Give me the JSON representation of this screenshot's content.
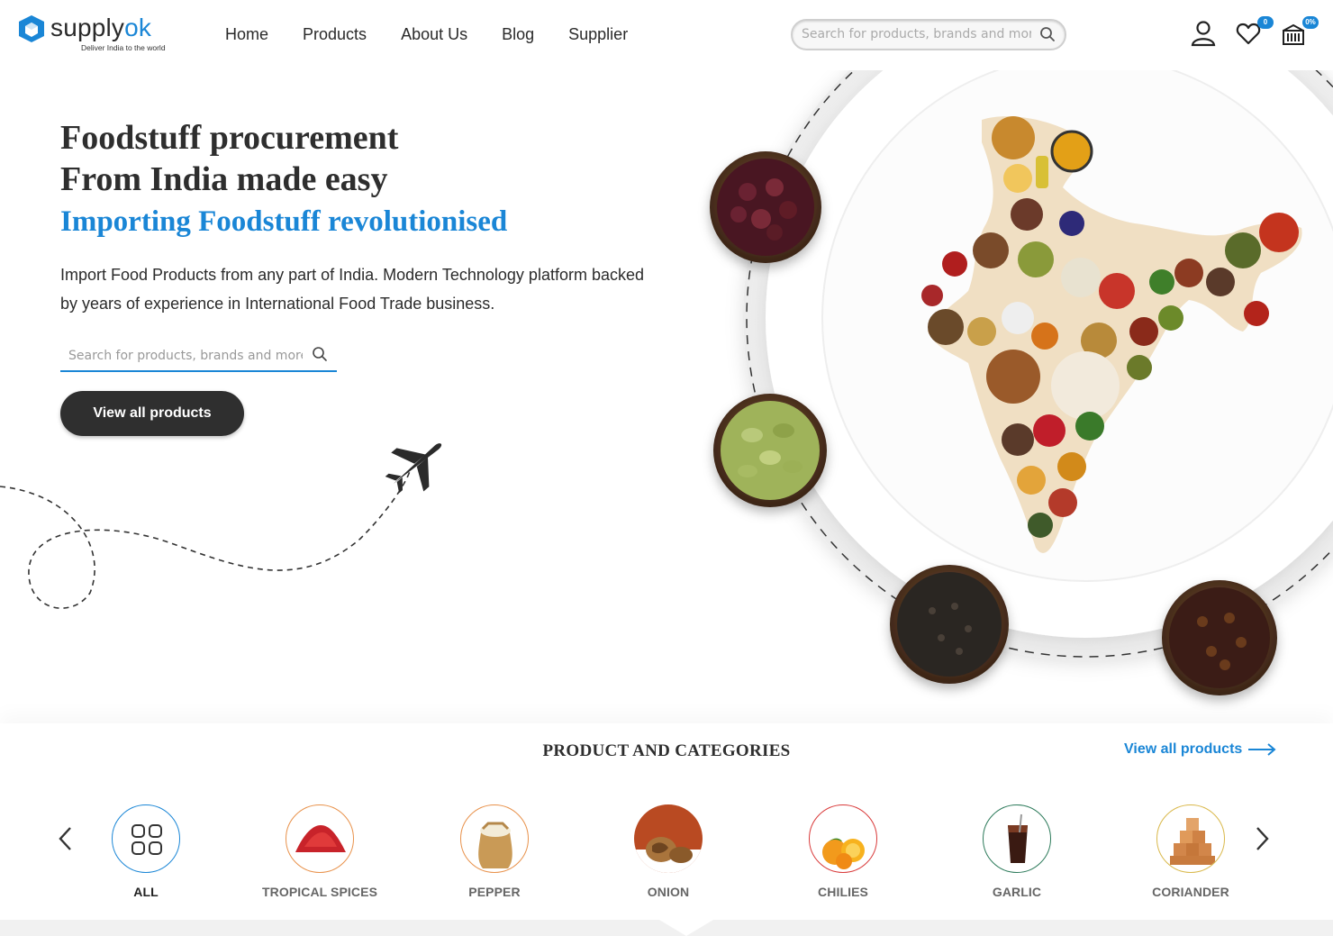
{
  "brand": {
    "name_part1": "supply",
    "name_part2": "ok",
    "tagline": "Deliver India to the world"
  },
  "nav": {
    "items": [
      "Home",
      "Products",
      "About Us",
      "Blog",
      "Supplier"
    ]
  },
  "header_search": {
    "placeholder": "Search for products, brands and more"
  },
  "header_icons": {
    "wishlist_count": "0",
    "cart_badge": "0%"
  },
  "hero": {
    "title_line1": "Foodstuff procurement",
    "title_line2": "From India made easy",
    "subtitle": "Importing Foodstuff revolutionised",
    "description": "Import Food Products from any part of India. Modern Technology platform backed by years of experience in International Food Trade business.",
    "search_placeholder": "Search for products, brands and more",
    "cta_label": "View all products"
  },
  "categories": {
    "title": "PRODUCT AND CATEGORIES",
    "view_all_label": "View all products",
    "items": [
      {
        "label": "ALL",
        "icon": "grid-icon"
      },
      {
        "label": "TROPICAL SPICES",
        "icon": "red-chili-powder-icon"
      },
      {
        "label": "PEPPER",
        "icon": "rice-sack-icon"
      },
      {
        "label": "ONION",
        "icon": "walnut-icon"
      },
      {
        "label": "CHILIES",
        "icon": "orange-fruit-icon"
      },
      {
        "label": "GARLIC",
        "icon": "cola-glass-icon"
      },
      {
        "label": "CORIANDER",
        "icon": "jaggery-cubes-icon"
      }
    ]
  },
  "colors": {
    "accent": "#1a86d6",
    "dark_button": "#2f2f2f"
  }
}
